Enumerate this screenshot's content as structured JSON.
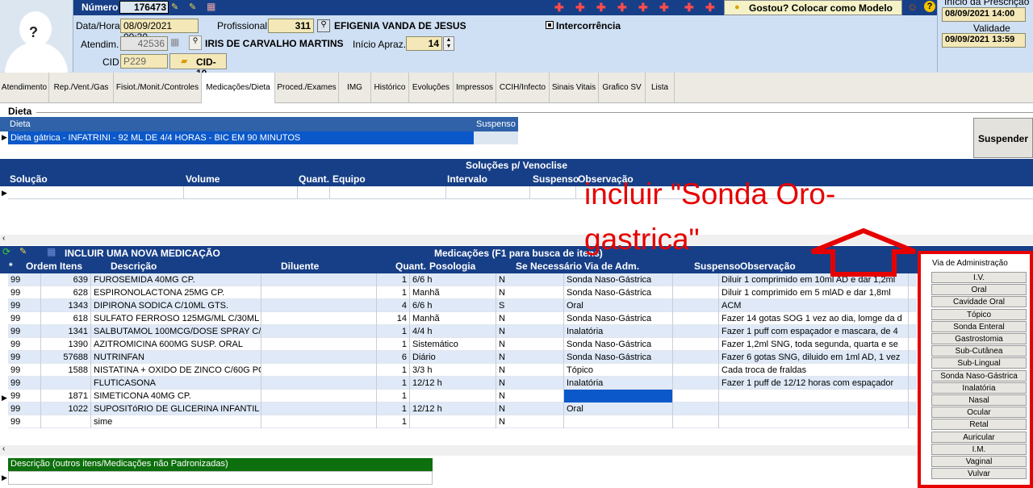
{
  "header": {
    "numero_label": "Número",
    "numero_value": "176473",
    "datahora_label": "Data/Hora",
    "datahora_value": "08/09/2021 09:30",
    "profissional_label": "Profissional",
    "profissional_code": "311",
    "profissional_name": "EFIGENIA VANDA DE JESUS",
    "intercorrencia_label": "Intercorrência",
    "atendim_label": "Atendim.",
    "atendim_value": "42536",
    "paciente_name": "IRIS DE CARVALHO MARTINS",
    "inicio_aprazo_label": "Início Apraz.",
    "inicio_aprazo_value": "14",
    "cid_label": "CID",
    "cid_value": "P229",
    "cid10_button": "CID-10",
    "gostou_button": "Gostou? Colocar como Modelo",
    "inicio_prescricao_label": "Início da Prescrição",
    "inicio_prescricao_value": "08/09/2021 14:00",
    "validade_label": "Validade",
    "validade_value": "09/09/2021 13:59"
  },
  "tabs": [
    "Atendimento",
    "Rep./Vent./Gas",
    "Fisiot./Monit./Controles",
    "Medicações/Dieta",
    "Proced./Exames",
    "IMG",
    "Histórico",
    "Evoluções",
    "Impressos",
    "CCIH/Infecto",
    "Sinais Vitais",
    "Grafico SV",
    "Lista"
  ],
  "dieta": {
    "section_title": "Dieta",
    "col_dieta": "Dieta",
    "col_suspenso": "Suspenso",
    "row": "Dieta gátrica - INFATRINI - 92 ML DE 4/4 HORAS - BIC EM 90 MINUTOS",
    "suspender_button": "Suspender"
  },
  "solucoes": {
    "title": "Soluções p/ Venoclise",
    "columns": [
      "Solução",
      "Volume",
      "Quant.",
      "Equipo",
      "Intervalo",
      "Suspenso",
      "Observação"
    ]
  },
  "medicacoes": {
    "incluir_label": "INCLUIR UMA NOVA MEDICAÇÃO",
    "title": "Medicações (F1 para busca de itens)",
    "columns": [
      "*",
      "Ordem",
      "Itens",
      "Descrição",
      "Diluente",
      "Quant.",
      "Posologia",
      "Se Necessário",
      "Via  de Adm.",
      "Suspenso",
      "Observação"
    ],
    "rows": [
      {
        "ordem": "99",
        "itens": "639",
        "descricao": "FUROSEMIDA 40MG CP.",
        "diluente": "",
        "quant": "1",
        "posologia": "6/6 h",
        "se_nec": "N",
        "via": "Sonda Naso-Gástrica",
        "suspenso": "",
        "obs": "Diluir 1 comprimido em 10ml AD e dar 1,2ml"
      },
      {
        "ordem": "99",
        "itens": "628",
        "descricao": "ESPIRONOLACTONA 25MG CP.",
        "diluente": "",
        "quant": "1",
        "posologia": "Manhã",
        "se_nec": "N",
        "via": "Sonda Naso-Gástrica",
        "suspenso": "",
        "obs": "Diluir 1 comprimido em 5 mlAD e dar 1,8ml"
      },
      {
        "ordem": "99",
        "itens": "1343",
        "descricao": "DIPIRONA SODICA C/10ML GTS.",
        "diluente": "",
        "quant": "4",
        "posologia": "6/6 h",
        "se_nec": "S",
        "via": "Oral",
        "suspenso": "",
        "obs": "ACM"
      },
      {
        "ordem": "99",
        "itens": "618",
        "descricao": "SULFATO FERROSO 125MG/ML C/30ML G",
        "diluente": "",
        "quant": "14",
        "posologia": "Manhã",
        "se_nec": "N",
        "via": "Sonda Naso-Gástrica",
        "suspenso": "",
        "obs": "Fazer 14 gotas SOG 1 vez ao dia, lomge da d"
      },
      {
        "ordem": "99",
        "itens": "1341",
        "descricao": "SALBUTAMOL 100MCG/DOSE SPRAY C/1",
        "diluente": "",
        "quant": "1",
        "posologia": "4/4 h",
        "se_nec": "N",
        "via": "Inalatória",
        "suspenso": "",
        "obs": "Fazer 1 puff com espaçador e mascara, de 4"
      },
      {
        "ordem": "99",
        "itens": "1390",
        "descricao": "AZITROMICINA 600MG SUSP. ORAL",
        "diluente": "",
        "quant": "1",
        "posologia": "Sistemático",
        "se_nec": "N",
        "via": "Sonda Naso-Gástrica",
        "suspenso": "",
        "obs": "Fazer 1,2ml SNG, toda segunda, quarta e se"
      },
      {
        "ordem": "99",
        "itens": "57688",
        "descricao": "NUTRINFAN",
        "diluente": "",
        "quant": "6",
        "posologia": "Diário",
        "se_nec": "N",
        "via": "Sonda Naso-Gástrica",
        "suspenso": "",
        "obs": "Fazer 6 gotas SNG, diluido em 1ml AD, 1 vez"
      },
      {
        "ordem": "99",
        "itens": "1588",
        "descricao": "NISTATINA + OXIDO DE ZINCO C/60G POM",
        "diluente": "",
        "quant": "1",
        "posologia": "3/3 h",
        "se_nec": "N",
        "via": "Tópico",
        "suspenso": "",
        "obs": "Cada troca de fraldas"
      },
      {
        "ordem": "99",
        "itens": "",
        "descricao": "FLUTICASONA",
        "diluente": "",
        "quant": "1",
        "posologia": "12/12 h",
        "se_nec": "N",
        "via": "Inalatória",
        "suspenso": "",
        "obs": "Fazer 1 puff de 12/12 horas com espaçador"
      },
      {
        "ordem": "99",
        "itens": "1871",
        "descricao": "SIMETICONA 40MG CP.",
        "diluente": "",
        "quant": "1",
        "posologia": "",
        "se_nec": "N",
        "via": "",
        "suspenso": "",
        "obs": ""
      },
      {
        "ordem": "99",
        "itens": "1022",
        "descricao": "SUPOSITóRIO DE GLICERINA INFANTIL",
        "diluente": "",
        "quant": "1",
        "posologia": "12/12 h",
        "se_nec": "N",
        "via": "Oral",
        "suspenso": "",
        "obs": ""
      },
      {
        "ordem": "99",
        "itens": "",
        "descricao": "sime",
        "diluente": "",
        "quant": "1",
        "posologia": "",
        "se_nec": "N",
        "via": "",
        "suspenso": "",
        "obs": ""
      }
    ]
  },
  "outros": {
    "label": "Descrição (outros itens/Medicações não Padronizadas)"
  },
  "vias": {
    "title": "Via de Administração",
    "items": [
      "I.V.",
      "Oral",
      "Cavidade Oral",
      "Tópico",
      "Sonda Enteral",
      "Gastrostomia",
      "Sub-Cutânea",
      "Sub-Lingual",
      "Sonda Naso-Gástrica",
      "Inalatória",
      "Nasal",
      "Ocular",
      "Retal",
      "Auricular",
      "I.M.",
      "Vaginal",
      "Vulvar"
    ]
  },
  "annotation": {
    "line1": "incluir \"Sonda Oro-",
    "line2": "gastrica\""
  },
  "colors": {
    "header_blue": "#173f87",
    "annotation_red": "#e60000",
    "row_alt": "#dfe9f7",
    "selected": "#0a58c9"
  }
}
